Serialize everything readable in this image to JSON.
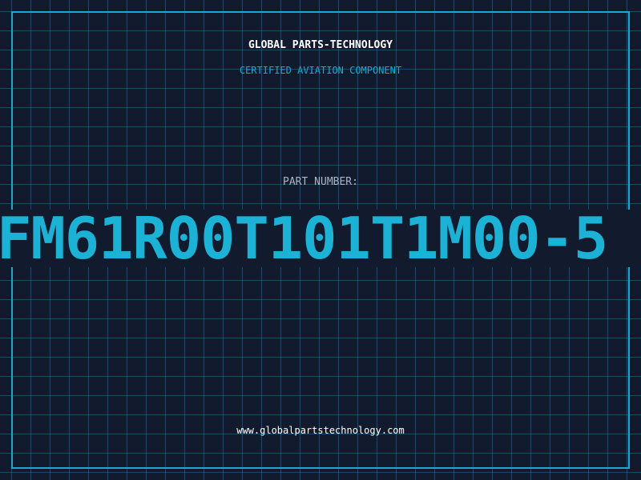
{
  "header": {
    "company": "GLOBAL PARTS-TECHNOLOGY",
    "subtitle": "CERTIFIED AVIATION COMPONENT"
  },
  "part": {
    "label": "PART NUMBER:",
    "number": "FM61R00T101T1M00-5"
  },
  "footer": {
    "website": "www.globalpartstechnology.com"
  },
  "colors": {
    "background": "#121a2e",
    "accent": "#1ba9d0",
    "grid": "#2c6e91",
    "text": "#ffffff"
  }
}
